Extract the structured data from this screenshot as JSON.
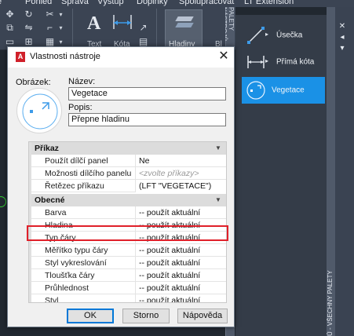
{
  "menubar": {
    "items": [
      "e",
      "Pohled",
      "Správa",
      "Výstup",
      "Doplňky",
      "Spolupracovat",
      "LT Extension"
    ]
  },
  "ribbon": {
    "text_label": "Text",
    "kota_label": "Kóta",
    "hladiny_label": "Hladiny",
    "bl_label": "Bl"
  },
  "palette": {
    "title_strip": "PALETY NÁSTROJŮ",
    "vertical_label": "Ů - VŠECHNY PALETY",
    "items": [
      {
        "label": "Úsečka",
        "icon": "line-icon"
      },
      {
        "label": "Přímá kóta",
        "icon": "linear-dimension-icon"
      },
      {
        "label": "Vegetace",
        "icon": "vegetation-icon"
      }
    ],
    "active_item": "Vegetace",
    "controls": {
      "close": "✕",
      "autohide": "◂",
      "properties": "▾"
    },
    "colors": {
      "active": "#1a91e6",
      "background": "#343c48"
    }
  },
  "dialog": {
    "title": "Vlastnosti nástroje",
    "close_icon": "✕",
    "image_label": "Obrázek:",
    "name_label": "Název:",
    "name_value": "Vegetace",
    "desc_label": "Popis:",
    "desc_value": "Přepne hladinu",
    "categories": [
      {
        "title": "Příkaz",
        "rows": [
          {
            "key": "Použít dílčí panel",
            "value": "Ne",
            "placeholder": false
          },
          {
            "key": "Možnosti dílčího panelu",
            "value": "<zvolte příkazy>",
            "placeholder": true
          },
          {
            "key": "Řetězec příkazu",
            "value": "(LFT \"VEGETACE\")",
            "placeholder": false
          }
        ]
      },
      {
        "title": "Obecné",
        "rows": [
          {
            "key": "Barva",
            "value": "-- použít aktuální",
            "placeholder": false
          },
          {
            "key": "Hladina",
            "value": "-- použít aktuální",
            "placeholder": false
          },
          {
            "key": "Typ čáry",
            "value": "-- použít aktuální",
            "placeholder": false
          },
          {
            "key": "Měřítko typu čáry",
            "value": "-- použít aktuální",
            "placeholder": false
          },
          {
            "key": "Styl vykreslování",
            "value": "-- použít aktuální",
            "placeholder": false
          },
          {
            "key": "Tloušťka čáry",
            "value": "-- použít aktuální",
            "placeholder": false
          },
          {
            "key": "Průhlednost",
            "value": "-- použít aktuální",
            "placeholder": false
          },
          {
            "key": "Styl",
            "value": "-- použít aktuální",
            "placeholder": false
          }
        ]
      }
    ],
    "highlight_color": "#e0202a",
    "buttons": {
      "ok": "OK",
      "cancel": "Storno",
      "help": "Nápověda"
    }
  }
}
